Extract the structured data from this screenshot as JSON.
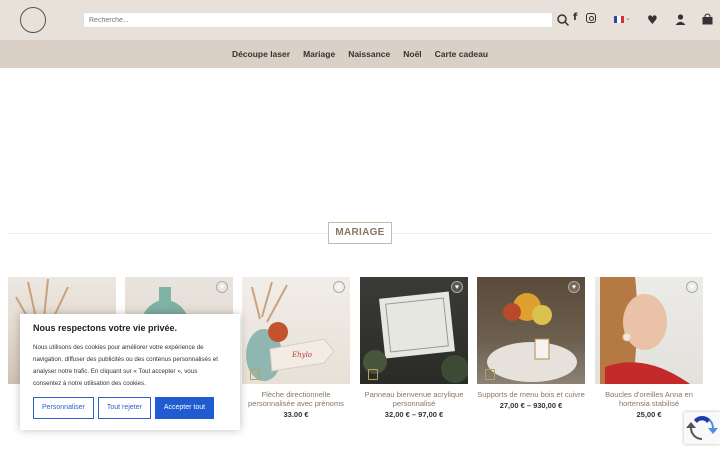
{
  "header": {
    "search_placeholder": "Recherche...",
    "fb_glyph": "f",
    "heart_glyph": "♥",
    "flag_colors": [
      "#2b4a9e",
      "#ffffff",
      "#d62f2f"
    ]
  },
  "nav": {
    "items": [
      "Découpe laser",
      "Mariage",
      "Naissance",
      "Noël",
      "Carte cadeau"
    ]
  },
  "section": {
    "title": "MARIAGE"
  },
  "products": [
    {
      "name": "",
      "price": ""
    },
    {
      "name": "",
      "price": ""
    },
    {
      "name": "Flèche directionnelle personnalisée avec prénoms",
      "price": "33.00 €"
    },
    {
      "name": "Panneau bienvenue acrylique personnalisé",
      "price": "32,00 € – 97,00 €"
    },
    {
      "name": "Supports de menu bois et cuivre",
      "price": "27,00 € – 930,00 €"
    },
    {
      "name": "Boucles d'oreilles Anna en hortensia stabilisé",
      "price": "25,00 €"
    }
  ],
  "cookie": {
    "title": "Nous respectons votre vie privée.",
    "text": "Nous utilisons des cookies pour améliorer votre expérience de navigation, diffuser des publicités ou des contenus personnalisés et analyser notre trafic. En cliquant sur « Tout accepter », vous consentez à notre utilisation des cookies.",
    "btn_customize": "Personnaliser",
    "btn_reject": "Tout rejeter",
    "btn_accept": "Accepter tout"
  },
  "colors": {
    "topbar": "#e8e1d9",
    "nav": "#dbd0c5",
    "accent": "#8a7563",
    "button_primary": "#1f5bd1"
  }
}
